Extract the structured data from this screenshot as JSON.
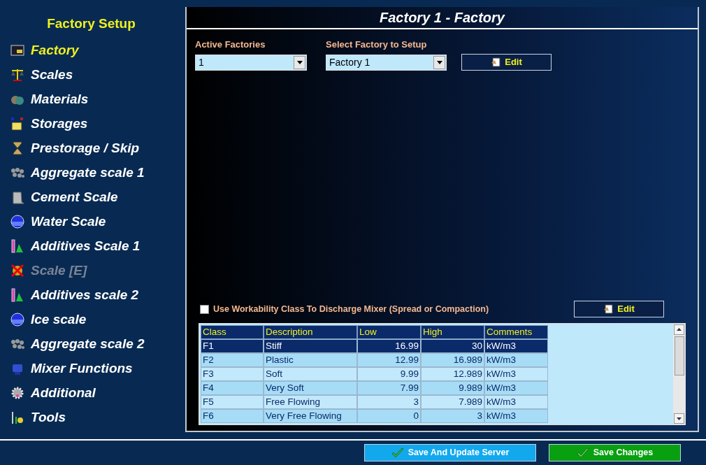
{
  "sidebar": {
    "title": "Factory Setup",
    "items": [
      {
        "label": "Factory",
        "selected": true,
        "disabled": false
      },
      {
        "label": "Scales",
        "selected": false,
        "disabled": false
      },
      {
        "label": "Materials",
        "selected": false,
        "disabled": false
      },
      {
        "label": "Storages",
        "selected": false,
        "disabled": false
      },
      {
        "label": "Prestorage / Skip",
        "selected": false,
        "disabled": false
      },
      {
        "label": "Aggregate scale 1",
        "selected": false,
        "disabled": false
      },
      {
        "label": "Cement Scale",
        "selected": false,
        "disabled": false
      },
      {
        "label": "Water Scale",
        "selected": false,
        "disabled": false
      },
      {
        "label": "Additives Scale 1",
        "selected": false,
        "disabled": false
      },
      {
        "label": "Scale [E]",
        "selected": false,
        "disabled": true
      },
      {
        "label": "Additives scale 2",
        "selected": false,
        "disabled": false
      },
      {
        "label": "Ice scale",
        "selected": false,
        "disabled": false
      },
      {
        "label": "Aggregate scale 2",
        "selected": false,
        "disabled": false
      },
      {
        "label": "Mixer Functions",
        "selected": false,
        "disabled": false
      },
      {
        "label": "Additional",
        "selected": false,
        "disabled": false
      },
      {
        "label": "Tools",
        "selected": false,
        "disabled": false
      }
    ]
  },
  "panel": {
    "title": "Factory 1 - Factory",
    "active_factories": {
      "label": "Active Factories",
      "value": "1"
    },
    "select_factory": {
      "label": "Select Factory to Setup",
      "value": "Factory 1"
    },
    "edit_button": "Edit",
    "workability": {
      "label": "Use Workability Class To Discharge Mixer (Spread or Compaction)",
      "checked": false
    },
    "workability_edit_button": "Edit",
    "table": {
      "columns": [
        "Class",
        "Description",
        "Low",
        "High",
        "Comments"
      ],
      "rows": [
        {
          "cells": [
            "F1",
            "Stiff",
            "16.99",
            "30",
            "kW/m3"
          ],
          "selected": true
        },
        {
          "cells": [
            "F2",
            "Plastic",
            "12.99",
            "16.989",
            "kW/m3"
          ],
          "selected": false
        },
        {
          "cells": [
            "F3",
            "Soft",
            "9.99",
            "12.989",
            "kW/m3"
          ],
          "selected": false
        },
        {
          "cells": [
            "F4",
            "Very Soft",
            "7.99",
            "9.989",
            "kW/m3"
          ],
          "selected": false
        },
        {
          "cells": [
            "F5",
            "Free Flowing",
            "3",
            "7.989",
            "kW/m3"
          ],
          "selected": false
        },
        {
          "cells": [
            "F6",
            "Very Free Flowing",
            "0",
            "3",
            "kW/m3"
          ],
          "selected": false
        }
      ]
    }
  },
  "footer": {
    "buttons": [
      "Save And Update Server",
      "Save Changes"
    ]
  }
}
